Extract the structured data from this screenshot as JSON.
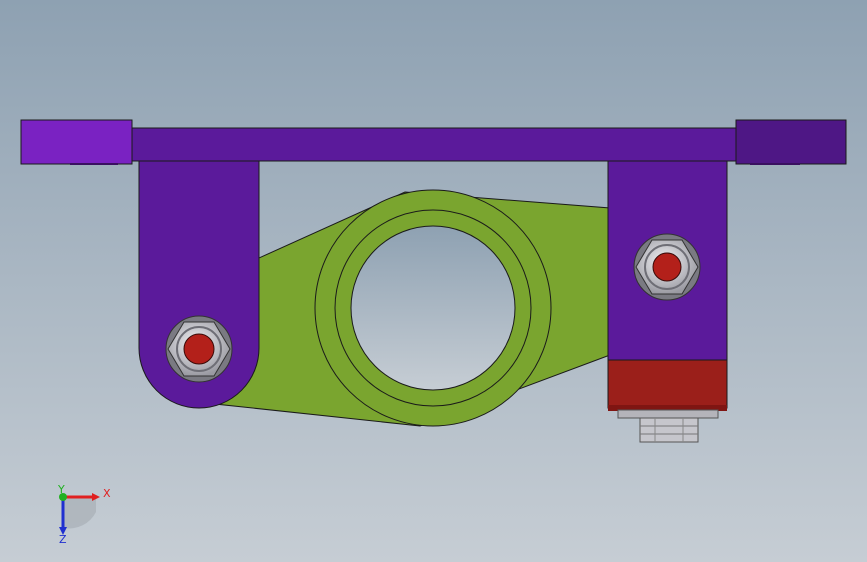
{
  "viewport": {
    "background_top": "#8EA1B2",
    "background_bottom": "#C6CDD4"
  },
  "colors": {
    "purple_main": "#5B1A9B",
    "purple_light": "#7A22C2",
    "purple_dark": "#4E1785",
    "green": "#7AA52F",
    "red_block": "#9B1F1A",
    "red_nut": "#B3201A",
    "steel": "#C9C9CF",
    "steel_dark": "#8E8E95",
    "outline": "#1A1A1A"
  },
  "triad": {
    "x_label": "X",
    "y_label": "Y",
    "z_label": "Z",
    "x_color": "#E02020",
    "y_color": "#20B020",
    "z_color": "#2030D0"
  },
  "parts": {
    "top_bar": "purple-crossbar",
    "left_bracket": "purple-left-bracket",
    "right_bracket": "purple-right-bracket",
    "arm": "green-cam-arm",
    "block": "red-mount-block",
    "connector": "steel-connector"
  }
}
